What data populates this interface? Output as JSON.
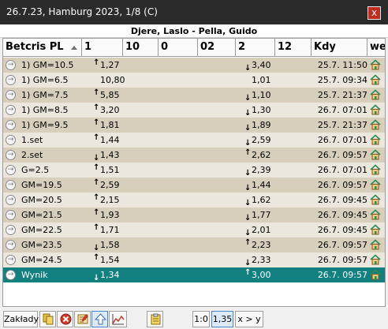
{
  "window": {
    "title": "26.7.23, Hamburg 2023, 1/8 (C)",
    "close_label": "x"
  },
  "event": {
    "title": "Djere, Laslo - Pella, Guido"
  },
  "columns": [
    {
      "label": "Betcris PL"
    },
    {
      "label": "1"
    },
    {
      "label": "10"
    },
    {
      "label": "0"
    },
    {
      "label": "02"
    },
    {
      "label": "2"
    },
    {
      "label": "12"
    },
    {
      "label": "Kdy"
    },
    {
      "label": "we"
    }
  ],
  "rows": [
    {
      "name": "1) GM=10.5",
      "v1": "1,27",
      "v1_dir": "up",
      "v2": "3,40",
      "v2_dir": "down",
      "kdy": "25.7. 11:50"
    },
    {
      "name": "1) GM=6.5",
      "v1": "10,80",
      "v1_dir": "",
      "v2": "1,01",
      "v2_dir": "",
      "kdy": "25.7. 09:34"
    },
    {
      "name": "1) GM=7.5",
      "v1": "5,85",
      "v1_dir": "up",
      "v2": "1,10",
      "v2_dir": "down",
      "kdy": "25.7. 21:37"
    },
    {
      "name": "1) GM=8.5",
      "v1": "3,20",
      "v1_dir": "up",
      "v2": "1,30",
      "v2_dir": "down",
      "kdy": "26.7. 07:01"
    },
    {
      "name": "1) GM=9.5",
      "v1": "1,81",
      "v1_dir": "up",
      "v2": "1,89",
      "v2_dir": "down",
      "kdy": "25.7. 21:37"
    },
    {
      "name": "1.set",
      "v1": "1,44",
      "v1_dir": "up",
      "v2": "2,59",
      "v2_dir": "down",
      "kdy": "26.7. 07:01"
    },
    {
      "name": "2.set",
      "v1": "1,43",
      "v1_dir": "down",
      "v2": "2,62",
      "v2_dir": "up",
      "kdy": "26.7. 09:57"
    },
    {
      "name": "G=2.5",
      "v1": "1,51",
      "v1_dir": "up",
      "v2": "2,39",
      "v2_dir": "down",
      "kdy": "26.7. 07:01"
    },
    {
      "name": "GM=19.5",
      "v1": "2,59",
      "v1_dir": "up",
      "v2": "1,44",
      "v2_dir": "down",
      "kdy": "26.7. 09:57"
    },
    {
      "name": "GM=20.5",
      "v1": "2,15",
      "v1_dir": "up",
      "v2": "1,62",
      "v2_dir": "down",
      "kdy": "26.7. 09:45"
    },
    {
      "name": "GM=21.5",
      "v1": "1,93",
      "v1_dir": "up",
      "v2": "1,77",
      "v2_dir": "down",
      "kdy": "26.7. 09:45"
    },
    {
      "name": "GM=22.5",
      "v1": "1,71",
      "v1_dir": "up",
      "v2": "2,01",
      "v2_dir": "down",
      "kdy": "26.7. 09:45"
    },
    {
      "name": "GM=23.5",
      "v1": "1,58",
      "v1_dir": "down",
      "v2": "2,23",
      "v2_dir": "up",
      "kdy": "26.7. 09:57"
    },
    {
      "name": "GM=24.5",
      "v1": "1,54",
      "v1_dir": "up",
      "v2": "2,33",
      "v2_dir": "down",
      "kdy": "26.7. 09:57"
    },
    {
      "name": "Wynik",
      "v1": "1,34",
      "v1_dir": "down",
      "v2": "3,00",
      "v2_dir": "up",
      "kdy": "26.7. 09:57",
      "selected": true
    }
  ],
  "toolbar": {
    "zaklady_label": "Zakłady",
    "ratio_label": "1:0",
    "odds_label": "1,35",
    "compare_label": "x > y",
    "icons": [
      "copy-icon",
      "delete-icon",
      "note-icon",
      "up-arrow-icon",
      "chart-icon",
      "clipboard-icon"
    ]
  },
  "colors": {
    "titlebar": "#2b2b2b",
    "close_button": "#c42b1c",
    "row_even": "#d7cfbc",
    "row_odd": "#ece7dc",
    "row_selected": "#138080",
    "home_icon": "#2e8b57"
  }
}
